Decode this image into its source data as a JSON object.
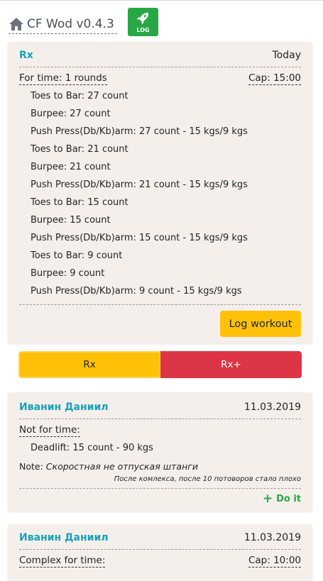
{
  "app": {
    "title": "CF Wod v0.4.3",
    "log_button_label": "LOG"
  },
  "current_wod": {
    "title": "Rx",
    "date": "Today",
    "type": "For time: 1 rounds",
    "cap": "Cap: 15:00",
    "exercises": [
      "Toes to Bar: 27 count",
      "Burpee: 27 count",
      "Push Press(Db/Kb)arm: 27 count - 15 kgs/9 kgs",
      "Toes to Bar: 21 count",
      "Burpee: 21 count",
      "Push Press(Db/Kb)arm: 21 count - 15 kgs/9 kgs",
      "Toes to Bar: 15 count",
      "Burpee: 15 count",
      "Push Press(Db/Kb)arm: 15 count - 15 kgs/9 kgs",
      "Toes to Bar: 9 count",
      "Burpee: 9 count",
      "Push Press(Db/Kb)arm: 9 count - 15 kgs/9 kgs"
    ],
    "log_label": "Log workout"
  },
  "level_toggle": {
    "left": "Rx",
    "right": "Rx+",
    "selected": "Rx"
  },
  "feed": [
    {
      "author": "Иванин Даниил",
      "date": "11.03.2019",
      "type": "Not for time:",
      "exercises": [
        "Deadlift: 15 count - 90 kgs"
      ],
      "note_label": "Note:",
      "note": "Скоростная не отпуская штанги",
      "comment": "После комлекса, после 10 потоворов стало плохо",
      "action": "Do it"
    },
    {
      "author": "Иванин Даниил",
      "date": "11.03.2019",
      "type": "Complex for time:",
      "cap": "Cap: 10:00"
    }
  ],
  "colors": {
    "accent": "#17a2b8",
    "warning": "#ffc107",
    "danger": "#dc3545",
    "success": "#28a745",
    "card": "#f4efeb"
  },
  "icons": {
    "brand": "home-icon",
    "log": "rocket-icon",
    "action": "plus-icon"
  }
}
